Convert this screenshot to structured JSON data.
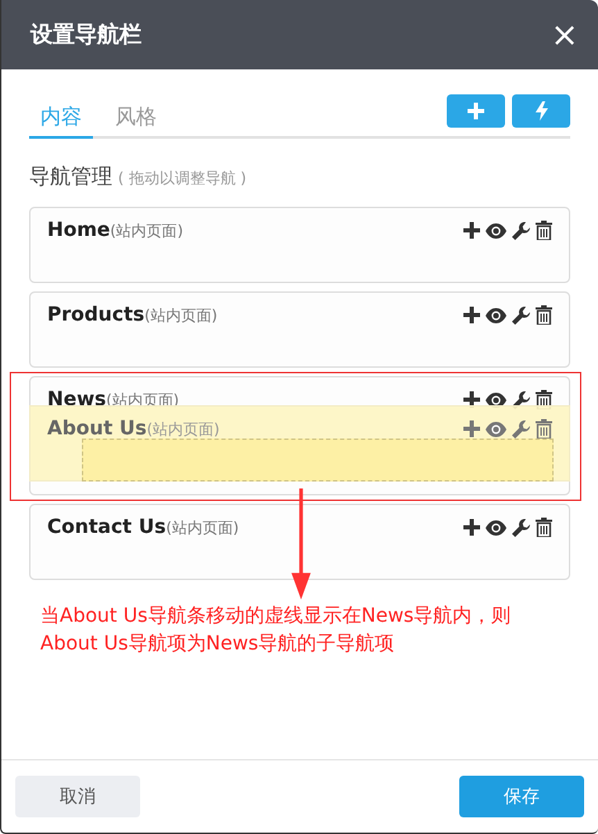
{
  "dialog": {
    "title": "设置导航栏",
    "close": "×"
  },
  "tabs": [
    {
      "label": "内容",
      "selected": true
    },
    {
      "label": "风格",
      "selected": false
    }
  ],
  "toolbar": [
    {
      "kind": "add"
    },
    {
      "kind": "flash"
    }
  ],
  "section": {
    "title": "导航管理",
    "hint": "( 拖动以调整导航 )"
  },
  "nav_items": [
    {
      "label": "Home",
      "note": "(站内页面)"
    },
    {
      "label": "Products",
      "note": "(站内页面)"
    },
    {
      "label": "News",
      "note": "(站内页面)",
      "drag_preview": {
        "label": "About Us",
        "note": "(站内页面)"
      }
    },
    {
      "label": "Contact Us",
      "note": "(站内页面)"
    }
  ],
  "annotation": {
    "text": "当About Us导航条移动的虚线显示在News导航内，则About Us导航项为News导航的子导航项"
  },
  "footer": {
    "cancel": "取消",
    "save": "保存"
  }
}
